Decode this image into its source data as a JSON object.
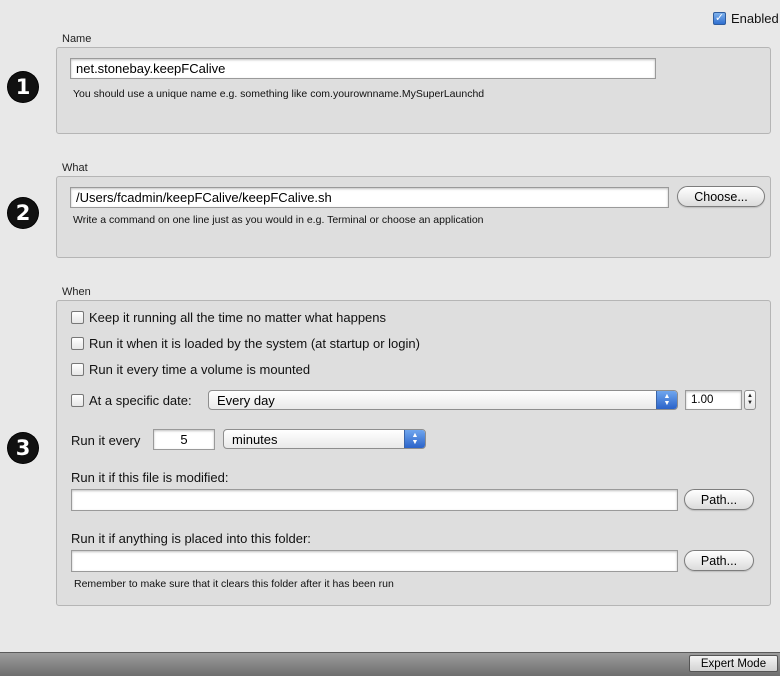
{
  "enabled": {
    "label": "Enabled",
    "checked": true
  },
  "sections": {
    "name": {
      "step": "1",
      "label": "Name",
      "value": "net.stonebay.keepFCalive",
      "hint": "You should use a unique name e.g. something like com.yourownname.MySuperLaunchd"
    },
    "what": {
      "step": "2",
      "label": "What",
      "value": "/Users/fcadmin/keepFCalive/keepFCalive.sh",
      "choose_label": "Choose...",
      "hint": "Write a command on one line just as you would in e.g. Terminal or choose an application"
    },
    "when": {
      "step": "3",
      "label": "When",
      "options": [
        {
          "label": "Keep it running all the time no matter what happens",
          "checked": false
        },
        {
          "label": "Run it when it is loaded by the system (at startup or login)",
          "checked": false
        },
        {
          "label": "Run it every time a volume is mounted",
          "checked": false
        }
      ],
      "specific_date": {
        "label": "At a specific date:",
        "checked": false,
        "selected": "Every day",
        "time_value": "1.00"
      },
      "run_every": {
        "label": "Run it every",
        "value": "5",
        "unit": "minutes"
      },
      "file_modified": {
        "label": "Run it if this file is modified:",
        "value": "",
        "path_label": "Path..."
      },
      "folder_placed": {
        "label": "Run it if anything is placed into this folder:",
        "value": "",
        "path_label": "Path...",
        "hint": "Remember to make sure that it clears this folder after it has been run"
      }
    }
  },
  "bottom": {
    "expert_label": "Expert Mode"
  },
  "colors": {
    "accent": "#2f6fd0",
    "panel": "#dedede",
    "background": "#e8e8e8"
  }
}
